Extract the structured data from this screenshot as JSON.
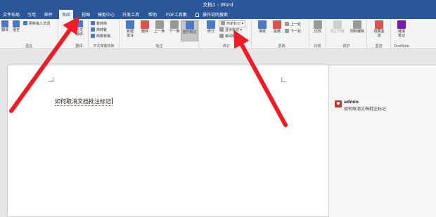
{
  "window": {
    "title": "文档1 - Word"
  },
  "tabs": [
    {
      "label": "文件"
    },
    {
      "label": "布局"
    },
    {
      "label": "引用"
    },
    {
      "label": "邮件"
    },
    {
      "label": "审阅"
    },
    {
      "label": "视图"
    },
    {
      "label": "模板中心"
    },
    {
      "label": "开发工具"
    },
    {
      "label": "帮助"
    },
    {
      "label": "PDF工具集"
    }
  ],
  "tell_me": "操作说明搜索",
  "ribbon": {
    "language": {
      "translate": "翻译",
      "lang": "语言",
      "update_ime": "更新输入法词",
      "group": "语言"
    },
    "fulltext": {
      "label_line1": "全文",
      "label_line2": "翻译",
      "group": "翻译"
    },
    "chinese": {
      "to_simplified": "繁转简",
      "to_traditional": "简转繁",
      "convert": "简繁转换",
      "group": "中文简繁转换"
    },
    "comments": {
      "new_line1": "新建",
      "new_line2": "批注",
      "delete": "删除",
      "prev": "上一条",
      "next": "下一条",
      "show": "显示批注",
      "group": "批注"
    },
    "tracking": {
      "track": "修订",
      "simple_markup": "简单标记",
      "show_markup": "显示标记",
      "review_pane": "审阅窗格",
      "group": "修订"
    },
    "changes": {
      "accept": "接受",
      "reject": "拒绝",
      "prev": "上一处",
      "next": "下一处",
      "group": "更改"
    },
    "compare": {
      "compare": "比较",
      "group": "比较"
    },
    "protect": {
      "block_authors": "阻止作者",
      "restrict": "限制编辑",
      "group": "保护"
    },
    "ink": {
      "hide_line1": "隐藏墨",
      "hide_line2": "迹",
      "group": "墨迹"
    },
    "onenote": {
      "line1": "链接",
      "line2": "笔记",
      "group": "OneNote"
    }
  },
  "document": {
    "body_text": "如何取消文档批注标记"
  },
  "comment": {
    "author": "admin",
    "text": "如何取消文档批注标记"
  },
  "colors": {
    "accent": "#2b579a",
    "arrow": "#ee1c25"
  }
}
